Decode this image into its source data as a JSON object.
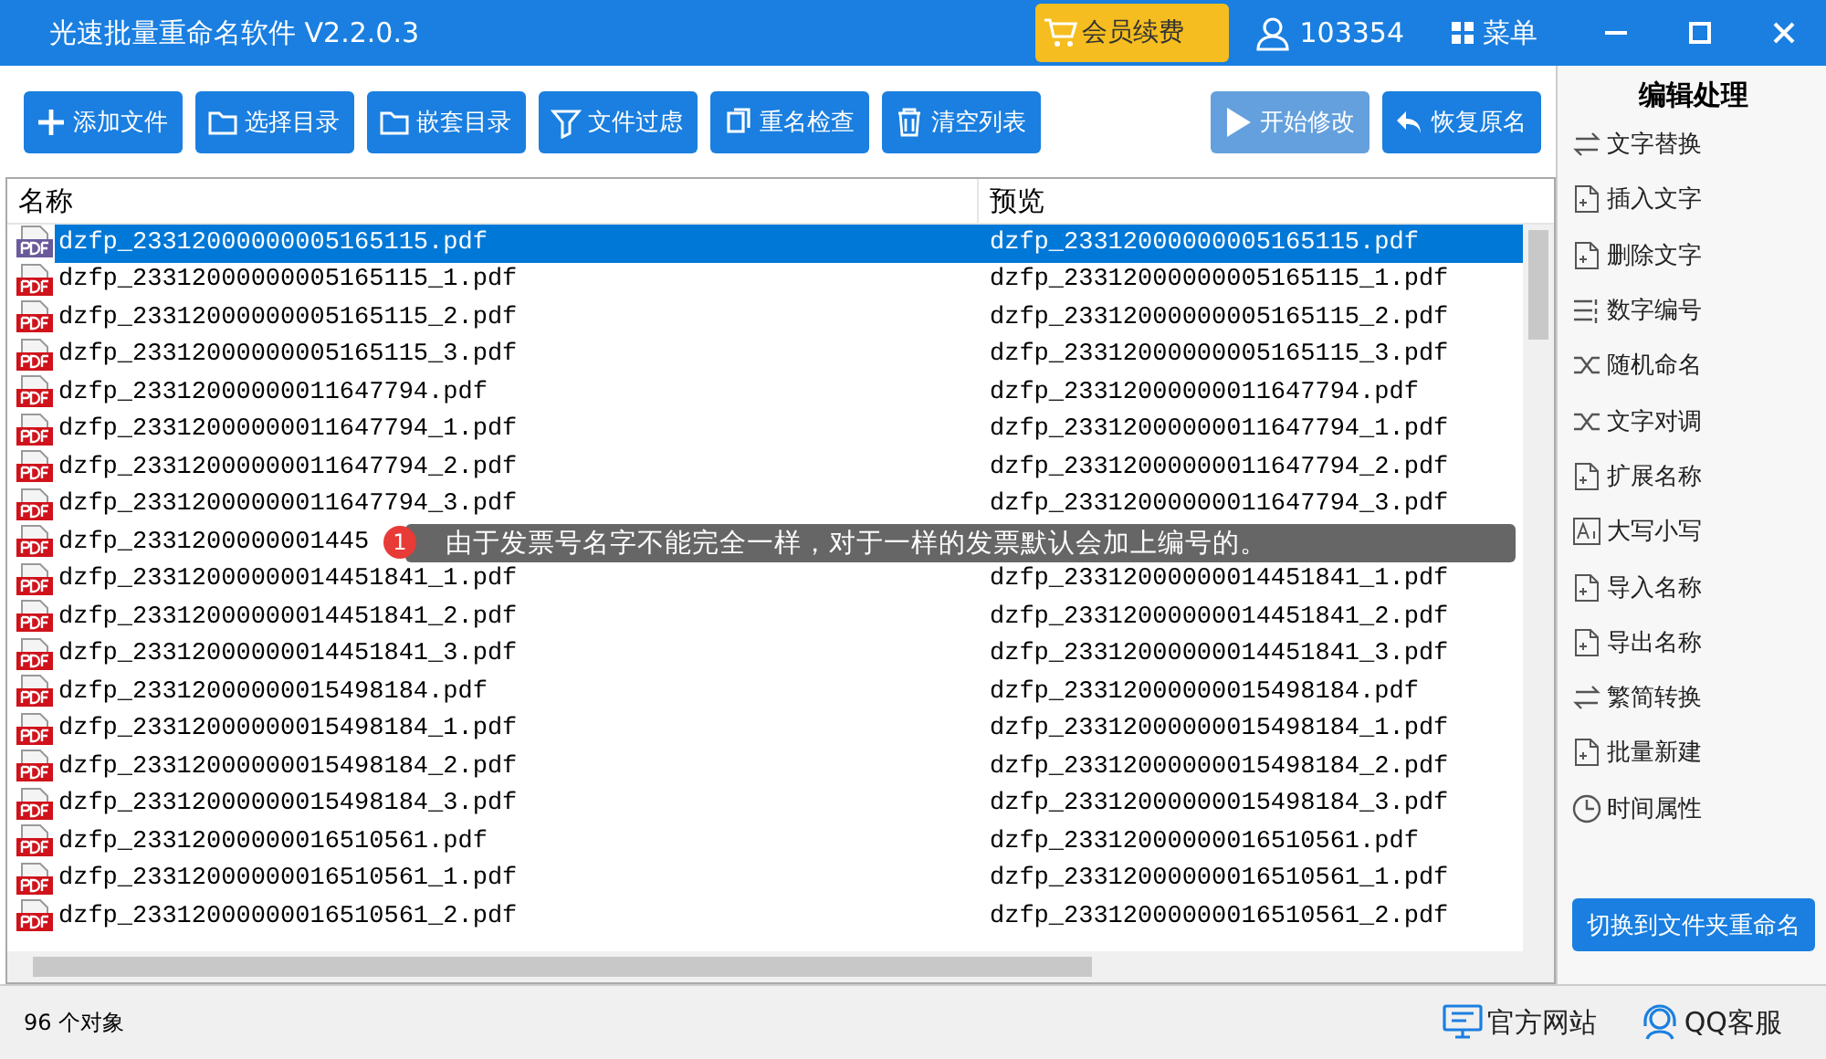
{
  "window": {
    "title": "光速批量重命名软件 V2.2.0.3",
    "vip_button": "会员续费",
    "user_id": "103354",
    "menu": "菜单"
  },
  "toolbar": [
    {
      "label": "添加文件",
      "disabled": false
    },
    {
      "label": "选择目录",
      "disabled": false
    },
    {
      "label": "嵌套目录",
      "disabled": false
    },
    {
      "label": "文件过虑",
      "disabled": false
    },
    {
      "label": "重名检查",
      "disabled": false
    },
    {
      "label": "清空列表",
      "disabled": false
    }
  ],
  "actions": [
    {
      "label": "开始修改",
      "disabled": true
    },
    {
      "label": "恢复原名",
      "disabled": false
    }
  ],
  "table": {
    "columns": [
      "名称",
      "预览"
    ],
    "rows": [
      {
        "name": "dzfp_23312000000005165115.pdf",
        "preview": "dzfp_23312000000005165115.pdf",
        "selected": true
      },
      {
        "name": "dzfp_23312000000005165115_1.pdf",
        "preview": "dzfp_23312000000005165115_1.pdf",
        "selected": false
      },
      {
        "name": "dzfp_23312000000005165115_2.pdf",
        "preview": "dzfp_23312000000005165115_2.pdf",
        "selected": false
      },
      {
        "name": "dzfp_23312000000005165115_3.pdf",
        "preview": "dzfp_23312000000005165115_3.pdf",
        "selected": false
      },
      {
        "name": "dzfp_23312000000011647794.pdf",
        "preview": "dzfp_23312000000011647794.pdf",
        "selected": false
      },
      {
        "name": "dzfp_23312000000011647794_1.pdf",
        "preview": "dzfp_23312000000011647794_1.pdf",
        "selected": false
      },
      {
        "name": "dzfp_23312000000011647794_2.pdf",
        "preview": "dzfp_23312000000011647794_2.pdf",
        "selected": false
      },
      {
        "name": "dzfp_23312000000011647794_3.pdf",
        "preview": "dzfp_23312000000011647794_3.pdf",
        "selected": false
      },
      {
        "name": "dzfp_2331200000001445",
        "selected": false
      },
      {
        "name": "dzfp_23312000000014451841_1.pdf",
        "preview": "dzfp_23312000000014451841_1.pdf",
        "selected": false
      },
      {
        "name": "dzfp_23312000000014451841_2.pdf",
        "preview": "dzfp_23312000000014451841_2.pdf",
        "selected": false
      },
      {
        "name": "dzfp_23312000000014451841_3.pdf",
        "preview": "dzfp_23312000000014451841_3.pdf",
        "selected": false
      },
      {
        "name": "dzfp_23312000000015498184.pdf",
        "preview": "dzfp_23312000000015498184.pdf",
        "selected": false
      },
      {
        "name": "dzfp_23312000000015498184_1.pdf",
        "preview": "dzfp_23312000000015498184_1.pdf",
        "selected": false
      },
      {
        "name": "dzfp_23312000000015498184_2.pdf",
        "preview": "dzfp_23312000000015498184_2.pdf",
        "selected": false
      },
      {
        "name": "dzfp_23312000000015498184_3.pdf",
        "preview": "dzfp_23312000000015498184_3.pdf",
        "selected": false
      },
      {
        "name": "dzfp_23312000000016510561.pdf",
        "preview": "dzfp_23312000000016510561.pdf",
        "selected": false
      },
      {
        "name": "dzfp_23312000000016510561_1.pdf",
        "preview": "dzfp_23312000000016510561_1.pdf",
        "selected": false
      },
      {
        "name": "dzfp_23312000000016510561_2.pdf",
        "preview": "dzfp_23312000000016510561_2.pdf",
        "selected": false
      }
    ]
  },
  "tooltip": {
    "badge": "1",
    "text": "由于发票号名字不能完全一样，对于一样的发票默认会加上编号的。"
  },
  "sidebar": {
    "title": "编辑处理",
    "items": [
      "文字替换",
      "插入文字",
      "删除文字",
      "数字编号",
      "随机命名",
      "文字对调",
      "扩展名称",
      "大写小写",
      "导入名称",
      "导出名称",
      "繁简转换",
      "批量新建",
      "时间属性"
    ],
    "switch_button": "切换到文件夹重命名"
  },
  "status_bar": {
    "count": "96 个对象",
    "website": "官方网站",
    "support": "QQ客服"
  }
}
